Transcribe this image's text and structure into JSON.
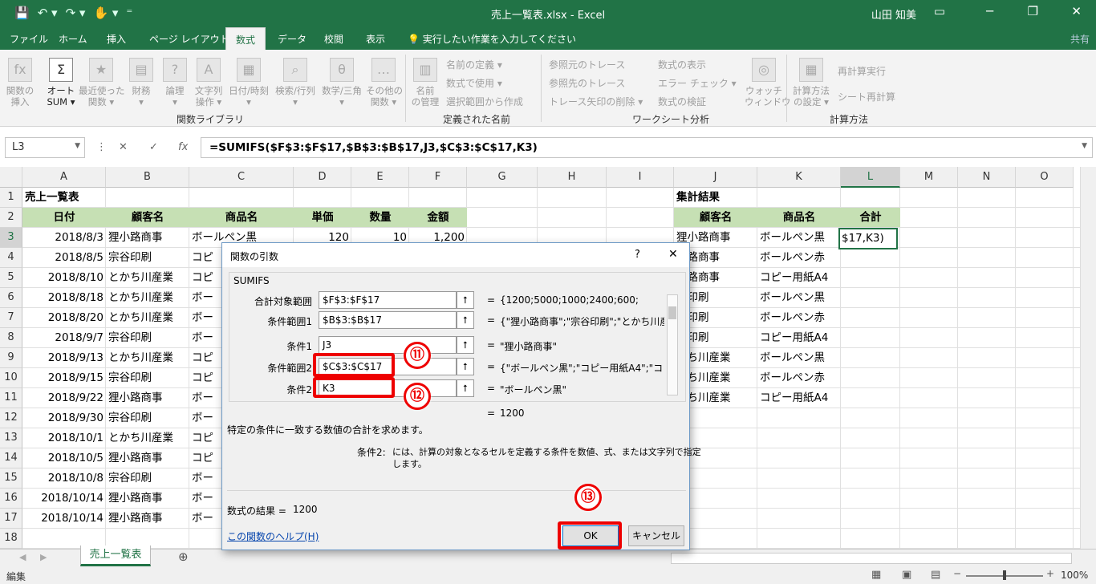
{
  "window": {
    "title": "売上一覧表.xlsx - Excel",
    "user": "山田 知美",
    "qat": [
      "💾",
      "↶ ▾",
      "↷ ▾",
      "✋ ▾",
      "⁼"
    ],
    "controls": [
      "▭",
      "─",
      "❐",
      "✕"
    ]
  },
  "tabs": [
    "ファイル",
    "ホーム",
    "挿入",
    "ページ レイアウト",
    "数式",
    "データ",
    "校閲",
    "表示",
    "💡 実行したい作業を入力してください"
  ],
  "active_tab": "数式",
  "share": "共有",
  "ribbon": {
    "fn_library": {
      "label": "関数ライブラリ",
      "buttons": [
        {
          "label": "関数の\n挿入",
          "icon": "fx-icon",
          "glyph": "fx"
        },
        {
          "label": "オート\nSUM ▾",
          "icon": "sigma-icon",
          "glyph": "Σ"
        },
        {
          "label": "最近使った\n関数 ▾",
          "icon": "star-icon",
          "glyph": "★"
        },
        {
          "label": "財務\n▾",
          "icon": "finance-icon",
          "glyph": "▤"
        },
        {
          "label": "論理\n▾",
          "icon": "logic-icon",
          "glyph": "?"
        },
        {
          "label": "文字列\n操作 ▾",
          "icon": "text-icon",
          "glyph": "A"
        },
        {
          "label": "日付/時刻\n▾",
          "icon": "date-icon",
          "glyph": "▦"
        },
        {
          "label": "検索/行列\n▾",
          "icon": "lookup-icon",
          "glyph": "⌕"
        },
        {
          "label": "数学/三角\n▾",
          "icon": "math-icon",
          "glyph": "θ"
        },
        {
          "label": "その他の\n関数 ▾",
          "icon": "more-fn-icon",
          "glyph": "…"
        }
      ]
    },
    "defined_names": {
      "label": "定義された名前",
      "big": {
        "label": "名前\nの管理",
        "glyph": "▥"
      },
      "small": [
        "名前の定義 ▾",
        "数式で使用 ▾",
        "選択範囲から作成"
      ]
    },
    "auditing": {
      "label": "ワークシート分析",
      "small": [
        "参照元のトレース",
        "参照先のトレース",
        "トレース矢印の削除 ▾",
        "数式の表示",
        "エラー チェック ▾",
        "数式の検証"
      ],
      "big": {
        "label": "ウォッチ\nウィンドウ",
        "glyph": "◎"
      }
    },
    "calculation": {
      "label": "計算方法",
      "big": {
        "label": "計算方法\nの設定 ▾",
        "glyph": "▦"
      },
      "small": [
        "再計算実行",
        "シート再計算"
      ]
    }
  },
  "name_box": "L3",
  "formula_icons": [
    "⋮",
    "✕",
    "✓",
    "fx"
  ],
  "formula": "=SUMIFS($F$3:$F$17,$B$3:$B$17,J3,$C$3:$C$17,K3)",
  "columns": [
    "A",
    "B",
    "C",
    "D",
    "E",
    "F",
    "G",
    "H",
    "I",
    "J",
    "K",
    "L",
    "M",
    "N",
    "O"
  ],
  "rows": [
    "1",
    "2",
    "3",
    "4",
    "5",
    "6",
    "7",
    "8",
    "9",
    "10",
    "11",
    "12",
    "13",
    "14",
    "15",
    "16",
    "17",
    "18"
  ],
  "sheet": {
    "title": "売上一覧表",
    "headers": [
      "日付",
      "顧客名",
      "商品名",
      "単価",
      "数量",
      "金額"
    ],
    "row3": [
      "2018/8/3",
      "狸小路商事",
      "ボールペン黒",
      "120",
      "10",
      "1,200"
    ],
    "dates": [
      "2018/8/5",
      "2018/8/10",
      "2018/8/18",
      "2018/8/20",
      "2018/9/7",
      "2018/9/13",
      "2018/9/15",
      "2018/9/22",
      "2018/9/30",
      "2018/10/1",
      "2018/10/5",
      "2018/10/8",
      "2018/10/14",
      "2018/10/14"
    ],
    "customers": [
      "宗谷印刷",
      "とかち川産業",
      "とかち川産業",
      "とかち川産業",
      "宗谷印刷",
      "とかち川産業",
      "宗谷印刷",
      "狸小路商事",
      "宗谷印刷",
      "とかち川産業",
      "狸小路商事",
      "宗谷印刷",
      "狸小路商事",
      "狸小路商事"
    ],
    "products": [
      "コピ",
      "コピ",
      "ボー",
      "ボー",
      "ボー",
      "コピ",
      "コピ",
      "ボー",
      "ボー",
      "コピ",
      "コピ",
      "ボー",
      "ボー",
      "ボー"
    ],
    "summary_title": "集計結果",
    "summary_headers": [
      "顧客名",
      "商品名",
      "合計"
    ],
    "summary_customers": [
      "狸小路商事",
      "小路商事",
      "小路商事",
      "谷印刷",
      "谷印刷",
      "谷印刷",
      "かち川産業",
      "かち川産業",
      "かち川産業"
    ],
    "summary_products": [
      "ボールペン黒",
      "ボールペン赤",
      "コピー用紙A4",
      "ボールペン黒",
      "ボールペン赤",
      "コピー用紙A4",
      "ボールペン黒",
      "ボールペン赤",
      "コピー用紙A4"
    ],
    "active_cell_text": "$17,K3)"
  },
  "sheet_tab": "売上一覧表",
  "status": "編集",
  "zoom": "100%",
  "dialog": {
    "title": "関数の引数",
    "help_mark": "?",
    "close": "✕",
    "function": "SUMIFS",
    "args": [
      {
        "label": "合計対象範囲",
        "value": "$F$3:$F$17",
        "result": "{1200;5000;1000;2400;600;"
      },
      {
        "label": "条件範囲1",
        "value": "$B$3:$B$17",
        "result": "{\"狸小路商事\";\"宗谷印刷\";\"とかち川産"
      },
      {
        "label": "条件1",
        "value": "J3",
        "result": "\"狸小路商事\""
      },
      {
        "label": "条件範囲2",
        "value": "$C$3:$C$17",
        "result": "{\"ボールペン黒\";\"コピー用紙A4\";\"コピー"
      },
      {
        "label": "条件2",
        "value": "K3",
        "result": "\"ボールペン黒\""
      }
    ],
    "eq": "=",
    "total": "1200",
    "description": "特定の条件に一致する数値の合計を求めます。",
    "arg_help_label": "条件2:",
    "arg_help_line1": "には、計算の対象となるセルを定義する条件を数値、式、または文字列で指定",
    "arg_help_line2": "します。",
    "result_label": "数式の結果 =",
    "result_value": "1200",
    "help_link": "この関数のヘルプ(H)",
    "ok": "OK",
    "cancel": "キャンセル"
  },
  "callouts": [
    "⑪",
    "⑫",
    "⑬"
  ],
  "colors": {
    "excel_green": "#217346",
    "header_fill": "#c6e0b4",
    "callout_red": "#e00000"
  }
}
